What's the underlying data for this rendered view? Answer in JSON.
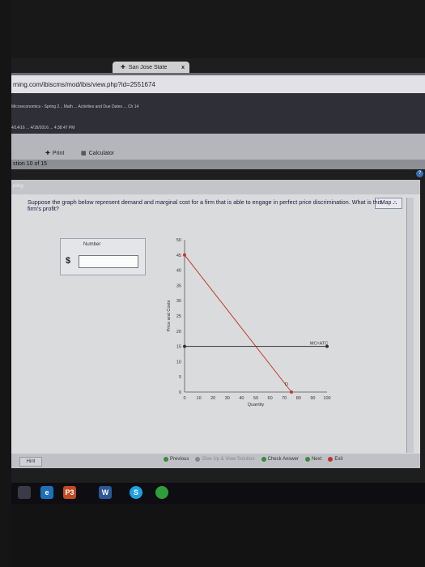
{
  "browser": {
    "tab_title": "San Jose State",
    "tab_close": "x",
    "url": "rning.com/ibiscms/mod/ibis/view.php?id=2551674"
  },
  "bookmarks": {
    "row1": "Microeconomics - Spring 2... Math ... Activities and Due Dates ... Ch 14",
    "row2": "4/14/16 ... 4/18/2016 ... 4:38:47 PM"
  },
  "toolbar": {
    "print_label": "Print",
    "calculator_label": "Calculator"
  },
  "question_counter": "stion 10 of 15",
  "content_tab": "pling",
  "map_label": "Map",
  "question_text": "Suppose the graph below represent demand and marginal cost for a firm that is able to engage in perfect price discrimination. What is this firm's profit?",
  "answer": {
    "label": "Number",
    "currency": "$",
    "value": ""
  },
  "chart_data": {
    "type": "line",
    "xlabel": "Quantity",
    "ylabel": "Price and Costs",
    "xlim": [
      0,
      100
    ],
    "ylim": [
      0,
      50
    ],
    "x_ticks": [
      "0",
      "10",
      "20",
      "30",
      "40",
      "50",
      "60",
      "70",
      "80",
      "90",
      "100"
    ],
    "y_ticks": [
      "0",
      "5",
      "10",
      "15",
      "20",
      "25",
      "30",
      "35",
      "40",
      "45",
      "50"
    ],
    "series": [
      {
        "name": "D",
        "points": [
          [
            0,
            45
          ],
          [
            75,
            0
          ]
        ],
        "color": "#c0392b"
      },
      {
        "name": "MC=ATC",
        "points": [
          [
            0,
            15
          ],
          [
            100,
            15
          ]
        ],
        "color": "#333333"
      }
    ],
    "grid": false
  },
  "bottom_nav": {
    "hint": "Hint",
    "previous": "Previous",
    "give_up": "Give Up & View Solution",
    "check": "Check Answer",
    "next": "Next",
    "exit": "Exit"
  },
  "taskbar": [
    "e",
    "P3",
    "W",
    "S",
    ""
  ]
}
